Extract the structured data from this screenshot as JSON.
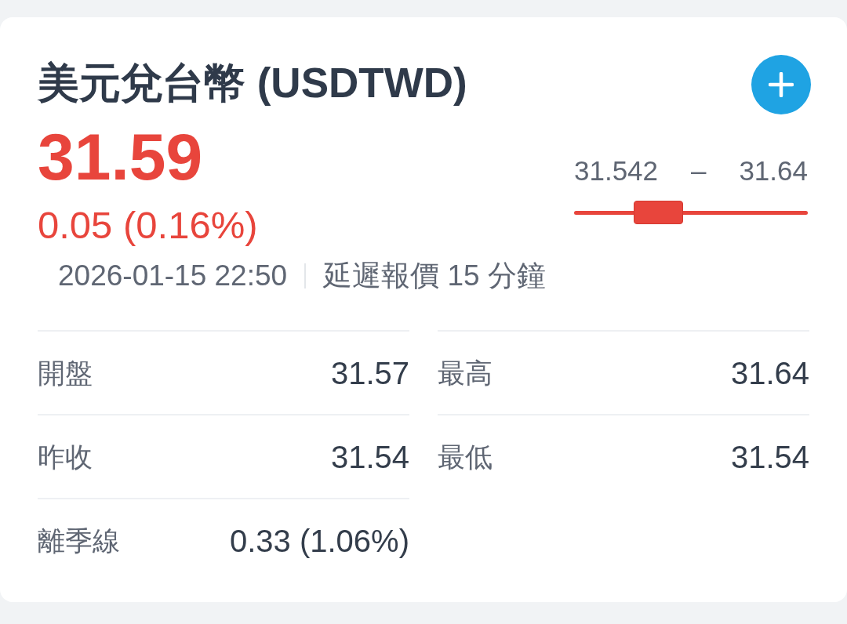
{
  "header": {
    "title": "美元兌台幣 (USDTWD)"
  },
  "quote": {
    "price": "31.59",
    "change": "0.05 (0.16%)",
    "rising": true,
    "timestamp": "2026-01-15 22:50",
    "delay_note": "延遲報價 15 分鐘"
  },
  "day_range": {
    "low": "31.542",
    "separator": "–",
    "high": "31.64",
    "level": 0.36
  },
  "stats": {
    "left_column": [
      {
        "label": "開盤",
        "value": "31.57"
      },
      {
        "label": "昨收",
        "value": "31.54"
      },
      {
        "label": "離季線",
        "value": "0.33 (1.06%)"
      }
    ],
    "right_column": [
      {
        "label": "最高",
        "value": "31.64"
      },
      {
        "label": "最低",
        "value": "31.54"
      }
    ]
  }
}
